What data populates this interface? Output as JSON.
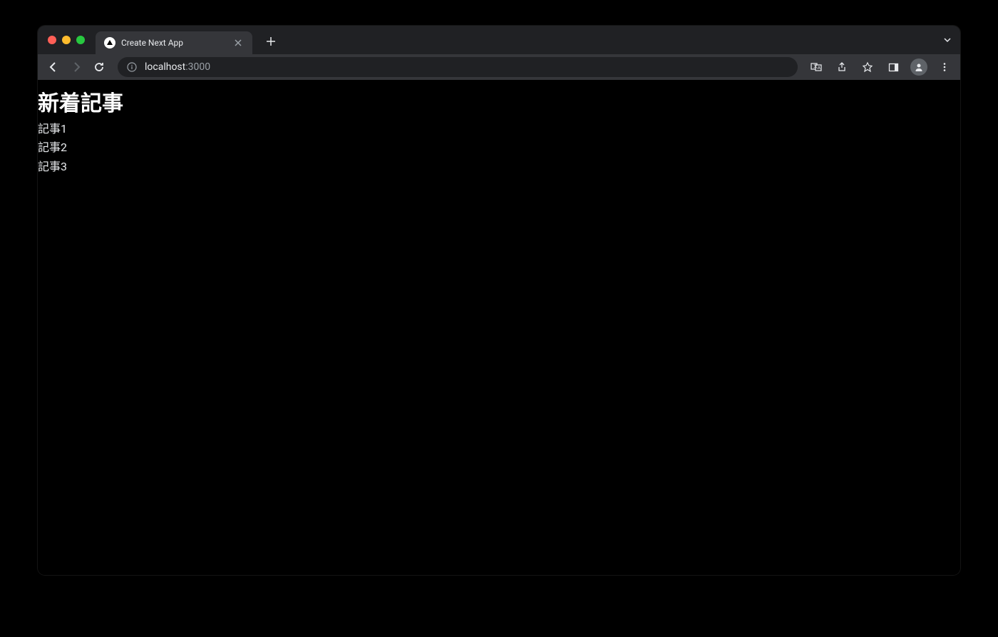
{
  "browser": {
    "tab": {
      "title": "Create Next App"
    },
    "url": {
      "host": "localhost",
      "port": ":3000"
    }
  },
  "page": {
    "heading": "新着記事",
    "articles": [
      "記事1",
      "記事2",
      "記事3"
    ]
  }
}
